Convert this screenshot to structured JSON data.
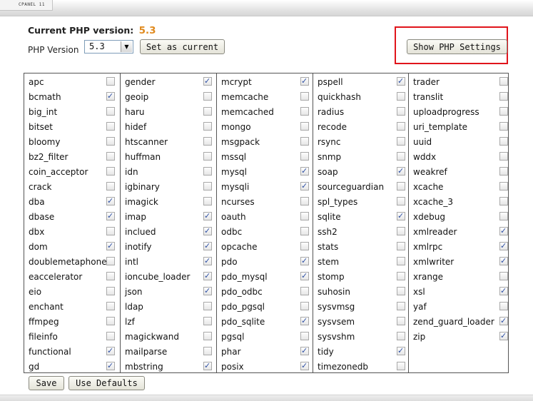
{
  "window": {
    "tab_label": "CPANEL 11"
  },
  "php": {
    "current_label": "Current PHP version:",
    "current_value": "5.3",
    "version_label": "PHP Version",
    "version_selected": "5.3",
    "set_current_button": "Set as current",
    "show_settings_button": "Show PHP Settings"
  },
  "columns": [
    {
      "items": [
        {
          "name": "apc",
          "checked": false
        },
        {
          "name": "bcmath",
          "checked": true
        },
        {
          "name": "big_int",
          "checked": false
        },
        {
          "name": "bitset",
          "checked": false
        },
        {
          "name": "bloomy",
          "checked": false
        },
        {
          "name": "bz2_filter",
          "checked": false
        },
        {
          "name": "coin_acceptor",
          "checked": false
        },
        {
          "name": "crack",
          "checked": false
        },
        {
          "name": "dba",
          "checked": true
        },
        {
          "name": "dbase",
          "checked": true
        },
        {
          "name": "dbx",
          "checked": false
        },
        {
          "name": "dom",
          "checked": true
        },
        {
          "name": "doublemetaphone",
          "checked": false
        },
        {
          "name": "eaccelerator",
          "checked": false
        },
        {
          "name": "eio",
          "checked": false
        },
        {
          "name": "enchant",
          "checked": false
        },
        {
          "name": "ffmpeg",
          "checked": false
        },
        {
          "name": "fileinfo",
          "checked": false
        },
        {
          "name": "functional",
          "checked": true
        },
        {
          "name": "gd",
          "checked": true
        }
      ]
    },
    {
      "items": [
        {
          "name": "gender",
          "checked": true
        },
        {
          "name": "geoip",
          "checked": false
        },
        {
          "name": "haru",
          "checked": false
        },
        {
          "name": "hidef",
          "checked": false
        },
        {
          "name": "htscanner",
          "checked": false
        },
        {
          "name": "huffman",
          "checked": false
        },
        {
          "name": "idn",
          "checked": false
        },
        {
          "name": "igbinary",
          "checked": false
        },
        {
          "name": "imagick",
          "checked": false
        },
        {
          "name": "imap",
          "checked": true
        },
        {
          "name": "inclued",
          "checked": true
        },
        {
          "name": "inotify",
          "checked": true
        },
        {
          "name": "intl",
          "checked": true
        },
        {
          "name": "ioncube_loader",
          "checked": true
        },
        {
          "name": "json",
          "checked": true
        },
        {
          "name": "ldap",
          "checked": false
        },
        {
          "name": "lzf",
          "checked": false
        },
        {
          "name": "magickwand",
          "checked": false
        },
        {
          "name": "mailparse",
          "checked": false
        },
        {
          "name": "mbstring",
          "checked": true
        }
      ]
    },
    {
      "items": [
        {
          "name": "mcrypt",
          "checked": true
        },
        {
          "name": "memcache",
          "checked": false
        },
        {
          "name": "memcached",
          "checked": false
        },
        {
          "name": "mongo",
          "checked": false
        },
        {
          "name": "msgpack",
          "checked": false
        },
        {
          "name": "mssql",
          "checked": false
        },
        {
          "name": "mysql",
          "checked": true
        },
        {
          "name": "mysqli",
          "checked": true
        },
        {
          "name": "ncurses",
          "checked": false
        },
        {
          "name": "oauth",
          "checked": false
        },
        {
          "name": "odbc",
          "checked": false
        },
        {
          "name": "opcache",
          "checked": false
        },
        {
          "name": "pdo",
          "checked": true
        },
        {
          "name": "pdo_mysql",
          "checked": true
        },
        {
          "name": "pdo_odbc",
          "checked": false
        },
        {
          "name": "pdo_pgsql",
          "checked": false
        },
        {
          "name": "pdo_sqlite",
          "checked": true
        },
        {
          "name": "pgsql",
          "checked": false
        },
        {
          "name": "phar",
          "checked": true
        },
        {
          "name": "posix",
          "checked": true
        }
      ]
    },
    {
      "items": [
        {
          "name": "pspell",
          "checked": true
        },
        {
          "name": "quickhash",
          "checked": false
        },
        {
          "name": "radius",
          "checked": false
        },
        {
          "name": "recode",
          "checked": false
        },
        {
          "name": "rsync",
          "checked": false
        },
        {
          "name": "snmp",
          "checked": false
        },
        {
          "name": "soap",
          "checked": true
        },
        {
          "name": "sourceguardian",
          "checked": false
        },
        {
          "name": "spl_types",
          "checked": false
        },
        {
          "name": "sqlite",
          "checked": true
        },
        {
          "name": "ssh2",
          "checked": false
        },
        {
          "name": "stats",
          "checked": false
        },
        {
          "name": "stem",
          "checked": false
        },
        {
          "name": "stomp",
          "checked": false
        },
        {
          "name": "suhosin",
          "checked": false
        },
        {
          "name": "sysvmsg",
          "checked": false
        },
        {
          "name": "sysvsem",
          "checked": false
        },
        {
          "name": "sysvshm",
          "checked": false
        },
        {
          "name": "tidy",
          "checked": true
        },
        {
          "name": "timezonedb",
          "checked": false
        }
      ]
    },
    {
      "items": [
        {
          "name": "trader",
          "checked": false
        },
        {
          "name": "translit",
          "checked": false
        },
        {
          "name": "uploadprogress",
          "checked": false
        },
        {
          "name": "uri_template",
          "checked": false
        },
        {
          "name": "uuid",
          "checked": false
        },
        {
          "name": "wddx",
          "checked": false
        },
        {
          "name": "weakref",
          "checked": false
        },
        {
          "name": "xcache",
          "checked": false
        },
        {
          "name": "xcache_3",
          "checked": false
        },
        {
          "name": "xdebug",
          "checked": false
        },
        {
          "name": "xmlreader",
          "checked": true
        },
        {
          "name": "xmlrpc",
          "checked": true
        },
        {
          "name": "xmlwriter",
          "checked": true
        },
        {
          "name": "xrange",
          "checked": false
        },
        {
          "name": "xsl",
          "checked": true
        },
        {
          "name": "yaf",
          "checked": false
        },
        {
          "name": "zend_guard_loader",
          "checked": true
        },
        {
          "name": "zip",
          "checked": true
        }
      ]
    }
  ],
  "footer": {
    "save_button": "Save",
    "defaults_button": "Use Defaults"
  },
  "colors": {
    "accent": "#e08a1e",
    "highlight": "#e0141b",
    "check": "#2d4fa3"
  }
}
